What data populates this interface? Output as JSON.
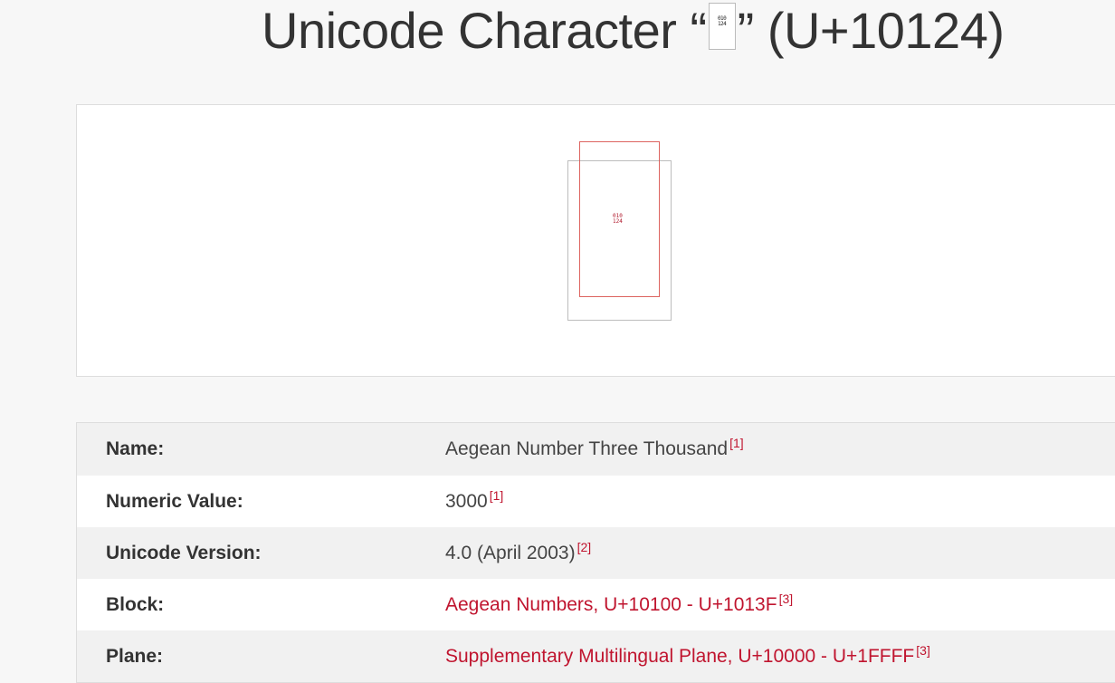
{
  "header": {
    "title_prefix": "Unicode Character “",
    "title_suffix": "” (U+10124)",
    "glyph_hex_top": "010",
    "glyph_hex_bottom": "124"
  },
  "preview": {
    "glyph_hex_top": "010",
    "glyph_hex_bottom": "124"
  },
  "properties": [
    {
      "label": "Name:",
      "value": "Aegean Number Three Thousand",
      "cite": "[1]",
      "is_link": false
    },
    {
      "label": "Numeric Value:",
      "value": "3000",
      "cite": "[1]",
      "is_link": false
    },
    {
      "label": "Unicode Version:",
      "value": "4.0 (April 2003)",
      "cite": "[2]",
      "is_link": false
    },
    {
      "label": "Block:",
      "value": "Aegean Numbers, U+10100 - U+1013F",
      "cite": "[3]",
      "is_link": true
    },
    {
      "label": "Plane:",
      "value": "Supplementary Multilingual Plane, U+10000 - U+1FFFF",
      "cite": "[3]",
      "is_link": true
    }
  ],
  "colors": {
    "accent": "#c0152f",
    "text": "#333333",
    "row_shade": "#f1f1f1"
  }
}
